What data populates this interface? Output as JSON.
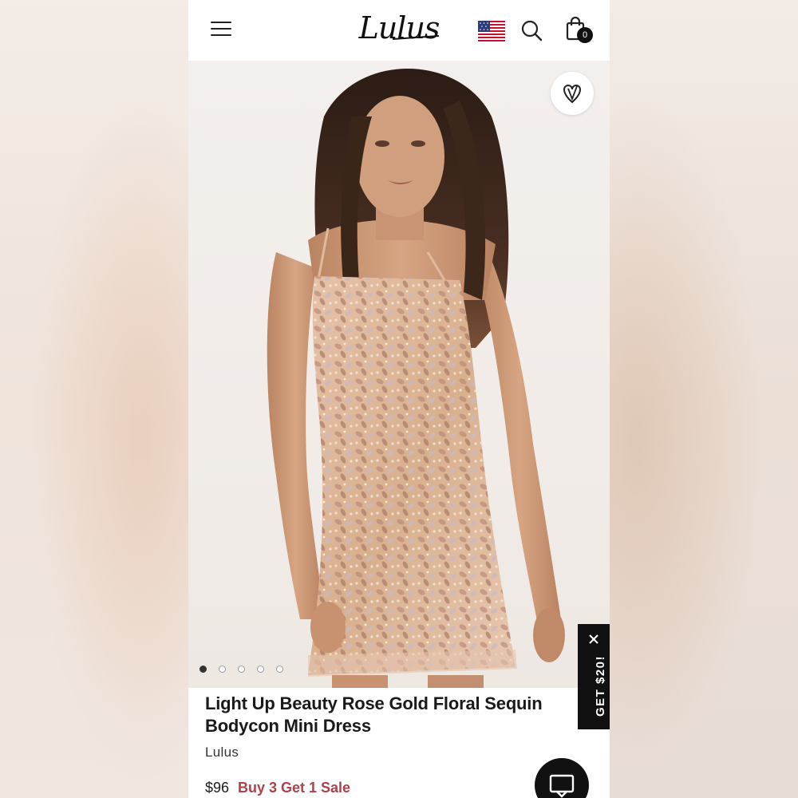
{
  "header": {
    "logo_text": "Lulus",
    "cart_count": "0"
  },
  "gallery": {
    "slide_count": 5,
    "active_slide": 1
  },
  "promo": {
    "label": "GET $20!"
  },
  "product": {
    "title": "Light Up Beauty Rose Gold Floral Sequin Bodycon Mini Dress",
    "brand": "Lulus",
    "price": "$96",
    "promotion": "Buy 3 Get 1 Sale"
  },
  "colors": {
    "accent_sale": "#b0404a",
    "dress_base": "#e9c7ad",
    "dark": "#111111"
  },
  "icons": [
    "menu-icon",
    "flag-icon",
    "search-icon",
    "bag-icon",
    "heart-icon",
    "close-icon",
    "chat-icon"
  ]
}
